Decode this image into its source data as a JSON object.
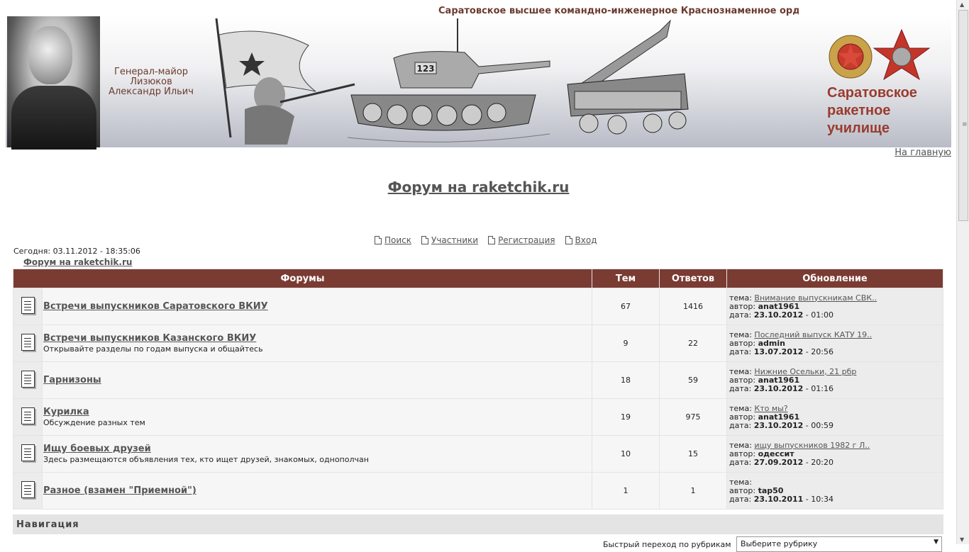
{
  "header": {
    "title": "Саратовское высшее командно-инженерное Краснознаменное ордена Кр",
    "general_lines": [
      "Генерал-майор",
      "Лизюков",
      "Александр Ильич"
    ],
    "school_lines": [
      "Саратовское",
      "ракетное",
      "училище"
    ],
    "tank_number": "123"
  },
  "home_link": "На главную",
  "forum_title": "Форум на raketchik.ru",
  "top_nav": [
    "Поиск",
    "Участники",
    "Регистрация",
    "Вход"
  ],
  "today": "Сегодня: 03.11.2012 - 18:35:06",
  "breadcrumb": "Форум на raketchik.ru",
  "table": {
    "headers": [
      "Форумы",
      "Тем",
      "Ответов",
      "Обновление"
    ],
    "labels": {
      "topic": "тема:",
      "author": "автор:",
      "date": "дата:"
    },
    "rows": [
      {
        "name": "Встречи выпускников Саратовского ВКИУ",
        "desc": "",
        "topics": "67",
        "replies": "1416",
        "last_topic": "Внимание выпускникам СВК..",
        "author": "anat1961",
        "date": "23.10.2012",
        "time": "01:00"
      },
      {
        "name": "Встречи выпускников Казанского ВКИУ",
        "desc": "Открывайте разделы по годам выпуска и общайтесь",
        "topics": "9",
        "replies": "22",
        "last_topic": "Последний выпуск КАТУ 19..",
        "author": "admin",
        "date": "13.07.2012",
        "time": "20:56"
      },
      {
        "name": "Гарнизоны",
        "desc": "",
        "topics": "18",
        "replies": "59",
        "last_topic": "Нижние Осельки, 21 рбр",
        "author": "anat1961",
        "date": "23.10.2012",
        "time": "01:16"
      },
      {
        "name": "Курилка",
        "desc": "Обсуждение разных тем",
        "topics": "19",
        "replies": "975",
        "last_topic": "Кто мы?",
        "author": "anat1961",
        "date": "23.10.2012",
        "time": "00:59"
      },
      {
        "name": "Ищу боевых друзей",
        "desc": "Здесь размещаются объявления тех, кто ищет друзей, знакомых, однополчан",
        "topics": "10",
        "replies": "15",
        "last_topic": "ищу выпускников 1982 г Л..",
        "author": "одессит",
        "date": "27.09.2012",
        "time": "20:20"
      },
      {
        "name": "Разное (взамен \"Приемной\")",
        "desc": "",
        "topics": "1",
        "replies": "1",
        "last_topic": "",
        "author": "tap50",
        "date": "23.10.2011",
        "time": "10:34"
      }
    ]
  },
  "navigation": {
    "title": "Навигация",
    "quick_label": "Быстрый переход по рубрикам",
    "select_value": "Выберите рубрику"
  },
  "colors": {
    "header_row": "#7a3b33",
    "brand_text": "#9a3b2e"
  }
}
